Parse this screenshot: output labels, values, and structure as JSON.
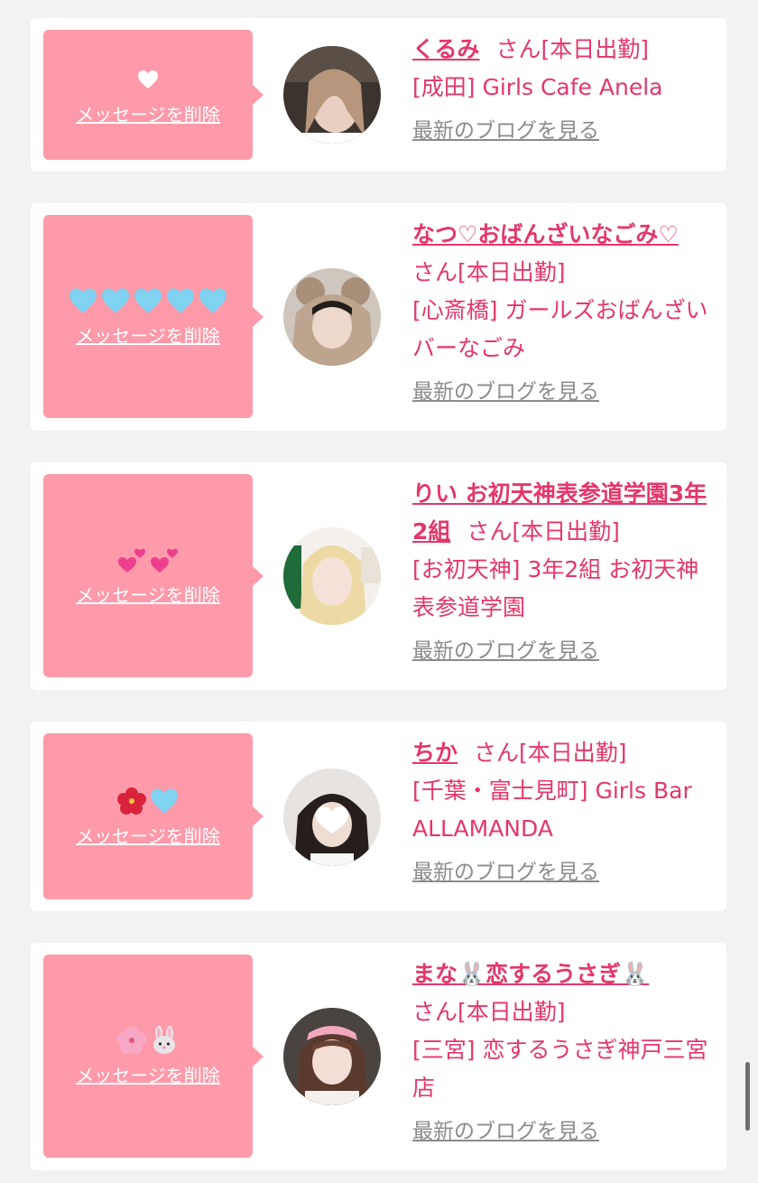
{
  "delete_label": "メッセージを削除",
  "blog_label": "最新のブログを見る",
  "suffix": "さん[本日出勤]",
  "cards": [
    {
      "emojis": [
        "white-heart"
      ],
      "name": "くるみ",
      "shop": "[成田] Girls Cafe Anela"
    },
    {
      "emojis": [
        "light-blue-heart",
        "light-blue-heart",
        "light-blue-heart",
        "light-blue-heart",
        "light-blue-heart"
      ],
      "name": "なつ♡おばんざいなごみ♡",
      "shop": "[心斎橋] ガールズおばんざいバーなごみ"
    },
    {
      "emojis": [
        "two-hearts",
        "two-hearts"
      ],
      "name": "りい お初天神表参道学園3年2組",
      "shop": "[お初天神] 3年2組 お初天神表参道学園"
    },
    {
      "emojis": [
        "hibiscus",
        "light-blue-heart"
      ],
      "name": "ちか",
      "shop": "[千葉・富士見町] Girls Bar ALLAMANDA"
    },
    {
      "emojis": [
        "cherry-blossom",
        "rabbit-face"
      ],
      "name": "まな🐰恋するうさぎ🐰",
      "shop": "[三宮] 恋するうさぎ神戸三宮店"
    }
  ],
  "colors": {
    "accent": "#e4376a",
    "bubble": "#fe9aa9",
    "link_gray": "#8b8b8b",
    "background": "#f2f2f3"
  }
}
